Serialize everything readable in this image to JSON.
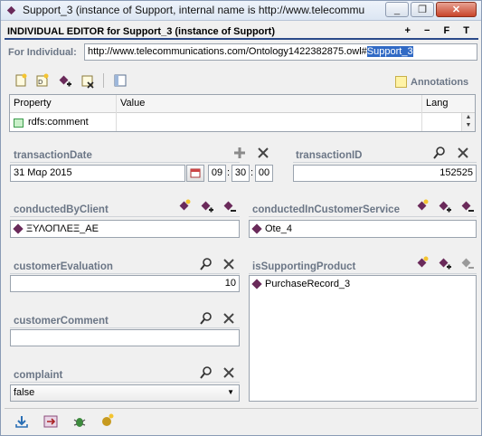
{
  "window": {
    "title": "Support_3   (instance of Support, internal name is http://www.telecommu",
    "buttons": {
      "minimize": "_",
      "restore": "❐",
      "close": "✕"
    }
  },
  "header": {
    "title": "INDIVIDUAL EDITOR for Support_3  (instance of Support)",
    "buttons": "+ − F T"
  },
  "for_individual": {
    "label": "For Individual:",
    "value_prefix": "http://www.telecommunications.com/Ontology1422382875.owl#",
    "value_selected": "Support_3"
  },
  "annotations": {
    "label": "Annotations"
  },
  "property_table": {
    "columns": [
      "Property",
      "Value",
      "Lang"
    ],
    "rows": [
      {
        "property": "rdfs:comment",
        "value": "",
        "lang": ""
      }
    ]
  },
  "fields": {
    "transactionDate": {
      "label": "transactionDate",
      "date": "31 Μαρ 2015",
      "hour": "09",
      "minute": "30",
      "second": "00",
      "sep": ":"
    },
    "transactionID": {
      "label": "transactionID",
      "value": "152525"
    },
    "conductedByClient": {
      "label": "conductedByClient",
      "items": [
        "ΞΥΛΟΠΛΕΞ_ΑΕ"
      ]
    },
    "conductedInCustomerService": {
      "label": "conductedInCustomerService",
      "items": [
        "Ote_4"
      ]
    },
    "customerEvaluation": {
      "label": "customerEvaluation",
      "value": "10"
    },
    "isSupportingProduct": {
      "label": "isSupportingProduct",
      "items": [
        "PurchaseRecord_3"
      ]
    },
    "customerComment": {
      "label": "customerComment",
      "value": ""
    },
    "complaint": {
      "label": "complaint",
      "value": "false"
    }
  },
  "colors": {
    "label_gray": "#6b7686",
    "instance_purple": "#6a2a5a",
    "selection_blue": "#316ac5",
    "header_rule": "#2b4a8a"
  },
  "icons": [
    "create-instance-icon",
    "create-instance-multi-icon",
    "add-icon",
    "delete-icon",
    "split-view-icon",
    "search-icon",
    "clear-icon",
    "calendar-icon",
    "export-icon",
    "convert-icon",
    "debug-icon",
    "hide-icon"
  ]
}
